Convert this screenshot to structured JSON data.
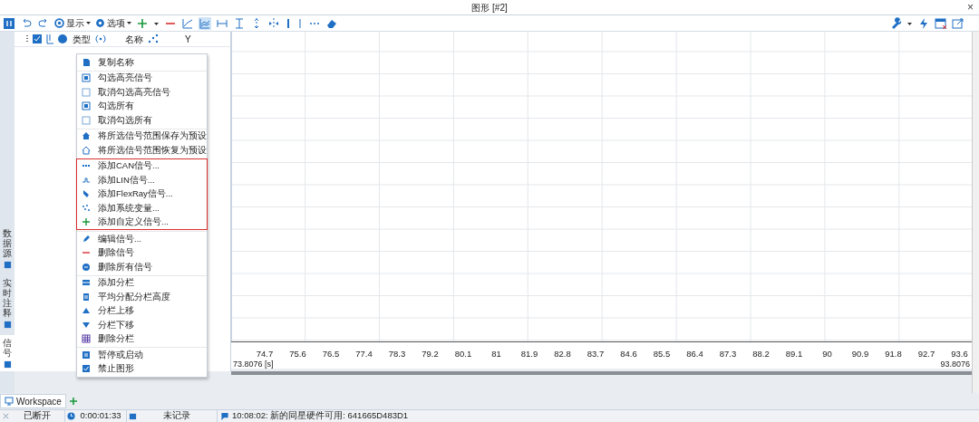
{
  "window": {
    "title": "图形 [#2]",
    "close": "×"
  },
  "toolbar": {
    "display_menu": "显示",
    "options_menu": "选项"
  },
  "signal_list": {
    "columns": [
      "类型",
      "名称",
      "Y"
    ]
  },
  "side_tabs": [
    {
      "label": "数据源",
      "selected": false
    },
    {
      "label": "实时注释",
      "selected": false
    },
    {
      "label": "信号",
      "selected": true
    }
  ],
  "context_menu": {
    "groups": [
      {
        "highlighted": false,
        "items": [
          {
            "kind": "copy",
            "label": "复制名称"
          }
        ]
      },
      {
        "highlighted": false,
        "items": [
          {
            "kind": "checked",
            "label": "勾选高亮信号"
          },
          {
            "kind": "unchecked",
            "label": "取消勾选高亮信号"
          },
          {
            "kind": "checked",
            "label": "勾选所有"
          },
          {
            "kind": "unchecked",
            "label": "取消勾选所有"
          }
        ]
      },
      {
        "highlighted": false,
        "items": [
          {
            "kind": "home",
            "label": "将所选信号范围保存为预设"
          },
          {
            "kind": "home-outline",
            "label": "将所选信号范围恢复为预设"
          }
        ]
      },
      {
        "highlighted": true,
        "items": [
          {
            "kind": "can",
            "label": "添加CAN信号..."
          },
          {
            "kind": "lin",
            "label": "添加LIN信号..."
          },
          {
            "kind": "flexray",
            "label": "添加FlexRay信号..."
          },
          {
            "kind": "sysvar",
            "label": "添加系统变量..."
          },
          {
            "kind": "plus",
            "label": "添加自定义信号..."
          }
        ]
      },
      {
        "highlighted": false,
        "items": [
          {
            "kind": "pencil",
            "label": "编辑信号..."
          },
          {
            "kind": "minus",
            "label": "删除信号"
          },
          {
            "kind": "remove-all",
            "label": "删除所有信号"
          }
        ]
      },
      {
        "highlighted": false,
        "items": [
          {
            "kind": "pane",
            "label": "添加分栏"
          },
          {
            "kind": "equal",
            "label": "平均分配分栏高度"
          },
          {
            "kind": "up",
            "label": "分栏上移"
          },
          {
            "kind": "down",
            "label": "分栏下移"
          },
          {
            "kind": "grid",
            "label": "删除分栏"
          }
        ]
      },
      {
        "highlighted": false,
        "items": [
          {
            "kind": "pause",
            "label": "暂停或启动"
          },
          {
            "kind": "checkbox",
            "label": "禁止图形"
          }
        ]
      }
    ]
  },
  "x_axis": {
    "ticks": [
      "74.7",
      "75.6",
      "76.5",
      "77.4",
      "78.3",
      "79.2",
      "80.1",
      "81",
      "81.9",
      "82.8",
      "83.7",
      "84.6",
      "85.5",
      "86.4",
      "87.3",
      "88.2",
      "89.1",
      "90",
      "90.9",
      "91.8",
      "92.7",
      "93.6"
    ],
    "start": "73.8076 [s]",
    "end": "93.8076"
  },
  "workspace_tab": {
    "label": "Workspace"
  },
  "status_bar": {
    "connection": "已断开",
    "time": "0:00:01:33",
    "recording": "未记录",
    "message": "10:08:02: 新的同星硬件可用: 641665D483D1"
  }
}
